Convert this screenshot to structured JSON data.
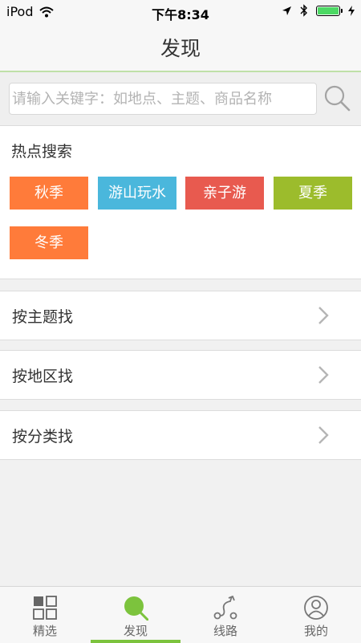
{
  "status_bar": {
    "carrier": "iPod",
    "time": "下午8:34",
    "battery_level": 1.0
  },
  "header": {
    "title": "发现"
  },
  "search": {
    "placeholder": "请输入关键字：如地点、主题、商品名称",
    "icon": "search-icon"
  },
  "hot_search": {
    "title": "热点搜索",
    "tags": [
      {
        "label": "秋季",
        "color": "#ff7b3a"
      },
      {
        "label": "游山玩水",
        "color": "#4ab7dc"
      },
      {
        "label": "亲子游",
        "color": "#e85a4f"
      },
      {
        "label": "夏季",
        "color": "#9cbc2c"
      },
      {
        "label": "冬季",
        "color": "#ff7b3a"
      }
    ]
  },
  "menu": [
    {
      "label": "按主题找"
    },
    {
      "label": "按地区找"
    },
    {
      "label": "按分类找"
    }
  ],
  "tabbar": {
    "items": [
      {
        "label": "精选",
        "icon": "grid-icon"
      },
      {
        "label": "发现",
        "icon": "discover-icon"
      },
      {
        "label": "线路",
        "icon": "route-icon"
      },
      {
        "label": "我的",
        "icon": "user-icon"
      }
    ],
    "active_index": 1,
    "accent": "#7cc33d"
  }
}
